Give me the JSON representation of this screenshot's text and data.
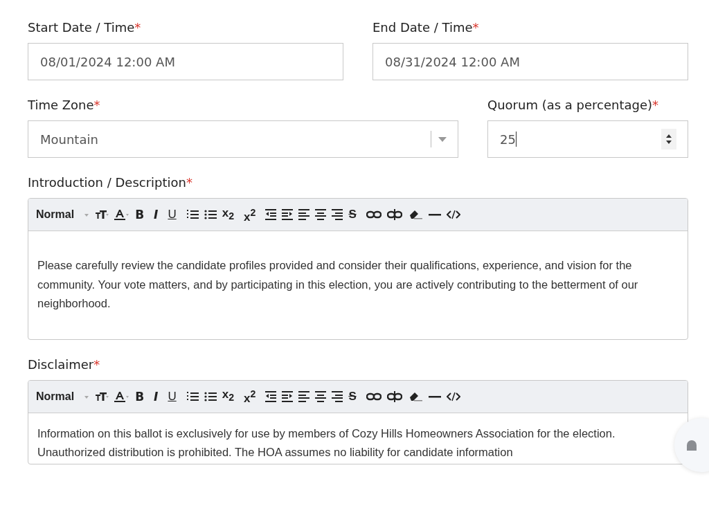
{
  "fields": [
    {
      "label": "Start Date / Time",
      "required_mark": "*",
      "kind": "text",
      "value": "08/01/2024 12:00 AM"
    },
    {
      "label": "End Date / Time",
      "required_mark": "*",
      "kind": "text",
      "value": "08/31/2024 12:00 AM"
    },
    {
      "label": "Time Zone",
      "required_mark": "*",
      "kind": "select",
      "value": "Mountain"
    },
    {
      "label": "Quorum (as a percentage)",
      "required_mark": "*",
      "kind": "number",
      "value": "25"
    }
  ],
  "editors": [
    {
      "label": "Introduction / Description",
      "required_mark": "*",
      "toolbar": {
        "style": "Normal",
        "bold": "B",
        "italic": "I",
        "underline": "U",
        "subscript": "x$_{2}$",
        "superscript": "x$^{2}$",
        "strike": "S"
      },
      "text": "Please carefully review the candidate profiles provided and consider their qualifications, experience, and vision for the community. Your vote matters, and by participating in this election, you are actively contributing to the betterment of our neighborhood."
    },
    {
      "label": "Disclaimer",
      "required_mark": "*",
      "toolbar": {
        "style": "Normal",
        "bold": "B",
        "italic": "I",
        "underline": "U",
        "subscript": "x$_{2}$",
        "superscript": "x$^{2}$",
        "strike": "S"
      },
      "text": "Information on this ballot is exclusively for use by members of Cozy Hills Homeowners Association for the election. Unauthorized distribution is prohibited. The HOA assumes no liability for candidate information"
    }
  ]
}
